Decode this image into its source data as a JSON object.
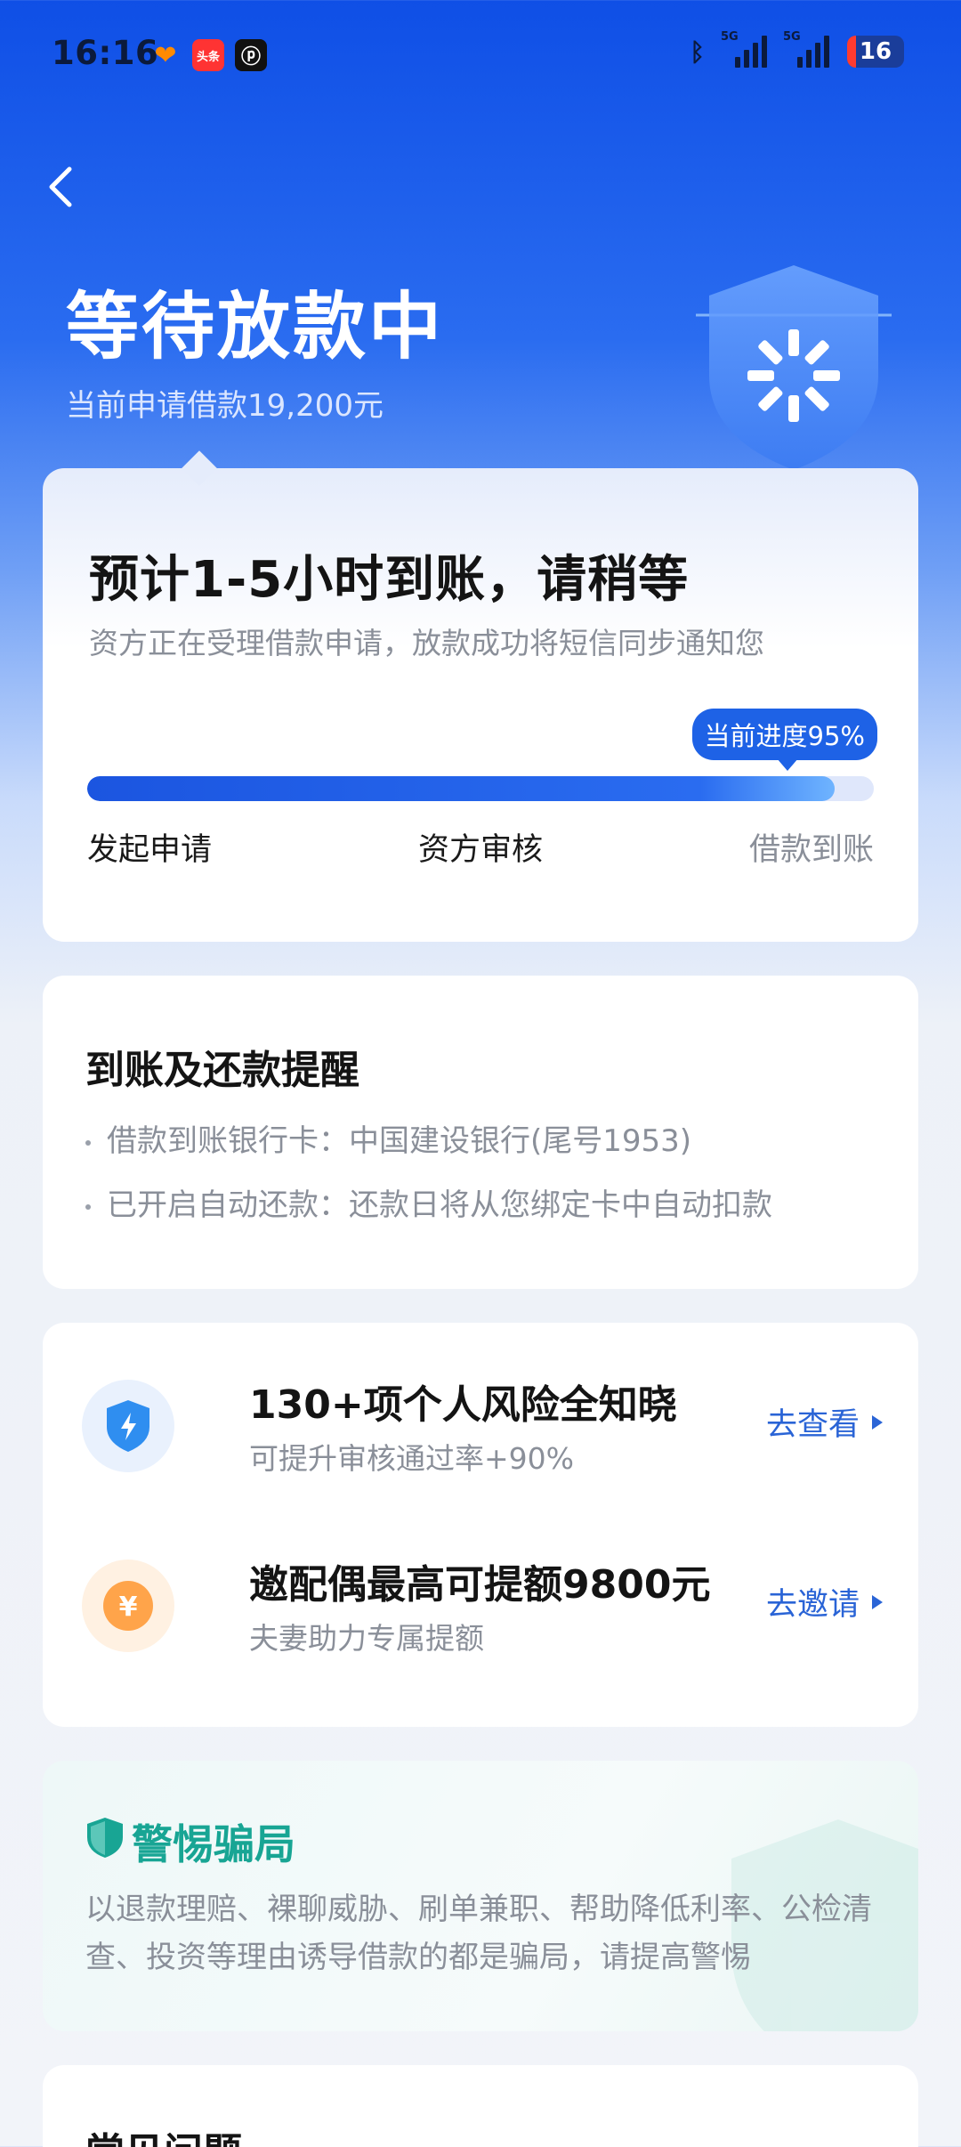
{
  "status_bar": {
    "time": "16:16",
    "battery": "16",
    "signal_label": "5G",
    "app_icons": [
      "app-icon-orange",
      "toutiao-icon",
      "p-icon"
    ],
    "toutiao_label": "头条"
  },
  "header": {
    "title": "等待放款中",
    "subtitle": "当前申请借款19,200元"
  },
  "progress_card": {
    "title": "预计1-5小时到账，请稍等",
    "description": "资方正在受理借款申请，放款成功将短信同步通知您",
    "badge": "当前进度95%",
    "progress": 0.95,
    "steps": [
      {
        "label": "发起申请",
        "done": true
      },
      {
        "label": "资方审核",
        "done": true
      },
      {
        "label": "借款到账",
        "done": false
      }
    ]
  },
  "reminder_card": {
    "title": "到账及还款提醒",
    "lines": [
      "借款到账银行卡：中国建设银行(尾号1953)",
      "已开启自动还款：还款日将从您绑定卡中自动扣款"
    ]
  },
  "promo_card": {
    "items": [
      {
        "title": "130+项个人风险全知晓",
        "subtitle": "可提升审核通过率+90%",
        "action": "去查看",
        "icon": "shield-bolt-icon",
        "color": "#2f8ef0"
      },
      {
        "title": "邀配偶最高可提额9800元",
        "subtitle": "夫妻助力专属提额",
        "action": "去邀请",
        "icon": "yuan-coin-icon",
        "color": "#ffa44a"
      }
    ]
  },
  "warning_card": {
    "title": "警惕骗局",
    "text": "以退款理赔、裸聊威胁、刷单兼职、帮助降低利率、公检清查、投资等理由诱导借款的都是骗局，请提高警惕",
    "accent": "#18a594"
  },
  "faq_card": {
    "title": "常见问题"
  },
  "colors": {
    "brand_blue": "#1e62e6",
    "link_blue": "#2a64d6"
  }
}
